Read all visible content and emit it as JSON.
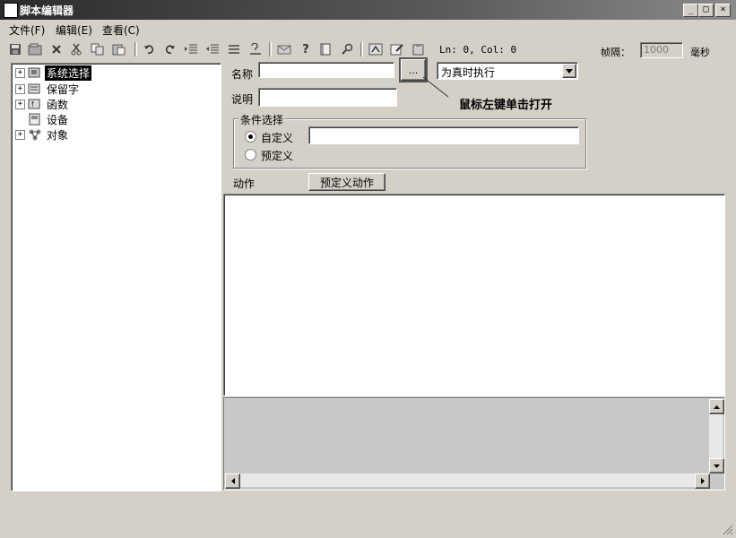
{
  "window": {
    "title": "脚本编辑器",
    "controls": {
      "minimize": "_",
      "maximize": "□",
      "close": "×"
    }
  },
  "menu": [
    "文件(F)",
    "编辑(E)",
    "查看(C)"
  ],
  "toolbar": {
    "icons": [
      "save-icon",
      "new-icon",
      "delete-icon",
      "cut-icon",
      "copy-icon",
      "paste-icon",
      "undo-icon",
      "redo-icon",
      "indent-icon",
      "outdent-icon",
      "comment-icon",
      "uncomment-icon",
      "message-icon",
      "help-icon",
      "book-icon",
      "find-icon",
      "compile-icon",
      "edit-icon",
      "clipboard-icon"
    ],
    "cursor_pos": "Ln: 0, Col: 0",
    "interval_label": "帧隔：",
    "interval_value": "1000",
    "interval_unit": "毫秒"
  },
  "tree": [
    {
      "label": "系统选择",
      "expander": "+",
      "icon": "system-icon",
      "selected": true
    },
    {
      "label": "保留字",
      "expander": "+",
      "icon": "keyword-icon",
      "selected": false
    },
    {
      "label": "函数",
      "expander": "+",
      "icon": "function-icon",
      "selected": false
    },
    {
      "label": "设备",
      "expander": "",
      "icon": "device-icon",
      "selected": false
    },
    {
      "label": "对象",
      "expander": "+",
      "icon": "object-icon",
      "selected": false
    }
  ],
  "form": {
    "name_label": "名称",
    "name_value": "",
    "browse_button": "...",
    "mode_select": "为真时执行",
    "desc_label": "说明",
    "desc_value": "",
    "hint": "鼠标左键单击打开",
    "condition_group": "条件选择",
    "radio_custom": "自定义",
    "radio_preset": "预定义",
    "condition_value": "",
    "action_label": "动作",
    "preset_action_button": "预定义动作"
  }
}
